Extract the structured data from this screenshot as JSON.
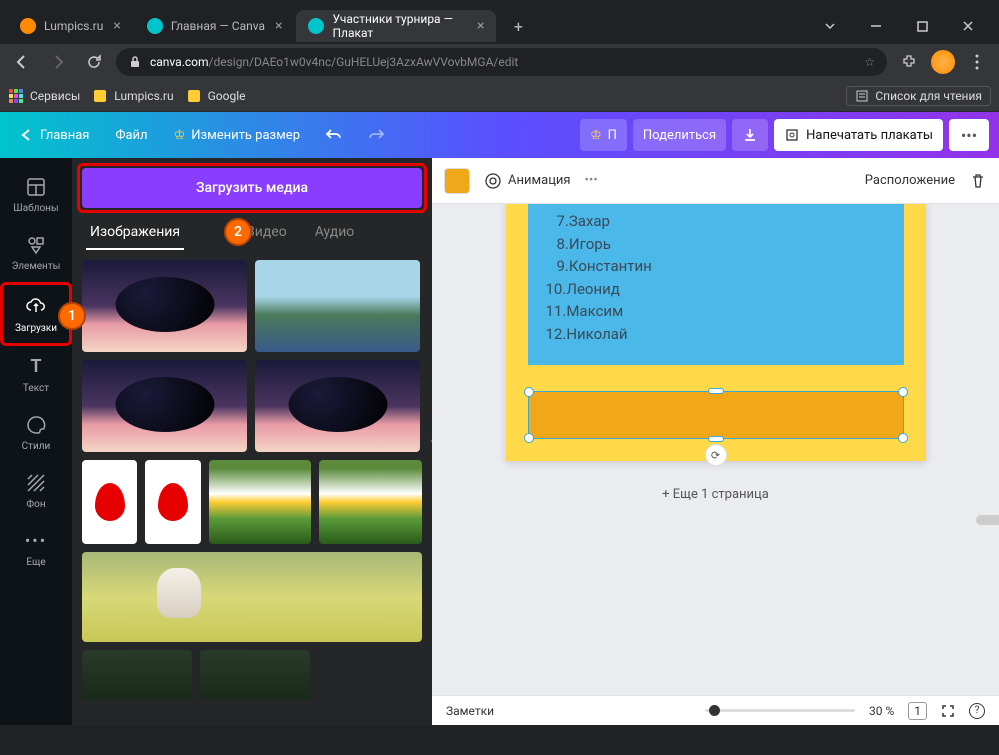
{
  "browser": {
    "tabs": [
      {
        "title": "Lumpics.ru",
        "favicon": "#ff8c00"
      },
      {
        "title": "Главная — Canva",
        "favicon": "#00c4cc"
      },
      {
        "title": "Участники турнира — Плакат",
        "favicon": "#00c4cc",
        "active": true
      }
    ],
    "url_host": "canva.com",
    "url_path": "/design/DAEo1w0v4nc/GuHELUej3AzxAwVVovbMGA/edit",
    "bookmarks": [
      {
        "label": "Сервисы",
        "color": "#e84a4a"
      },
      {
        "label": "Lumpics.ru",
        "color": "#ffcc33"
      },
      {
        "label": "Google",
        "color": "#ffcc33"
      }
    ],
    "reading_list": "Список для чтения"
  },
  "canva_bar": {
    "home": "Главная",
    "file": "Файл",
    "resize": "Изменить размер",
    "pro_short": "П",
    "share": "Поделиться",
    "print": "Напечатать плакаты"
  },
  "side_rail": [
    {
      "id": "templates",
      "label": "Шаблоны"
    },
    {
      "id": "elements",
      "label": "Элементы"
    },
    {
      "id": "uploads",
      "label": "Загрузки",
      "active": true
    },
    {
      "id": "text",
      "label": "Текст"
    },
    {
      "id": "styles",
      "label": "Стили"
    },
    {
      "id": "background",
      "label": "Фон"
    },
    {
      "id": "more",
      "label": "Еще"
    }
  ],
  "panel": {
    "upload_btn": "Загрузить медиа",
    "badge1": "1",
    "badge2": "2",
    "tabs": [
      {
        "label": "Изображения",
        "active": true
      },
      {
        "label": "Видео"
      },
      {
        "label": "Аудио"
      }
    ]
  },
  "canvas_toolbar": {
    "animation": "Анимация",
    "position": "Расположение"
  },
  "poster": {
    "items": [
      {
        "n": "7.",
        "name": "Захар"
      },
      {
        "n": "8.",
        "name": "Игорь"
      },
      {
        "n": "9.",
        "name": "Константин"
      },
      {
        "n": "10.",
        "name": "Леонид"
      },
      {
        "n": "11.",
        "name": "Максим"
      },
      {
        "n": "12.",
        "name": "Николай"
      }
    ]
  },
  "add_page": "+ Еще 1 страница",
  "bottom_bar": {
    "notes": "Заметки",
    "zoom": "30 %",
    "page": "1"
  }
}
